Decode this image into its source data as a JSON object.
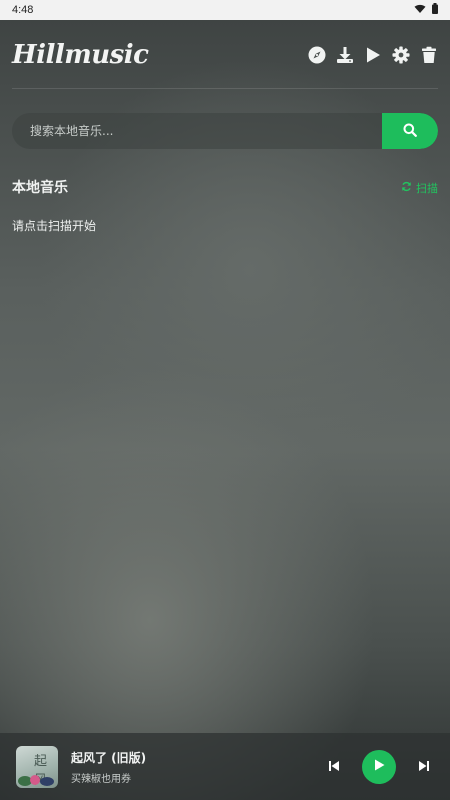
{
  "status_bar": {
    "time": "4:48"
  },
  "app": {
    "logo": "Hillmusic"
  },
  "toolbar": {
    "icons": [
      "compass-icon",
      "download-icon",
      "play-icon",
      "gear-icon",
      "trash-icon"
    ]
  },
  "search": {
    "placeholder": "搜索本地音乐..."
  },
  "section": {
    "title": "本地音乐",
    "scan_label": "扫描"
  },
  "empty_hint": "请点击扫描开始",
  "player": {
    "title": "起风了 (旧版)",
    "artist": "买辣椒也用券",
    "cover_text": "起风"
  },
  "colors": {
    "accent": "#1ebd5c"
  }
}
